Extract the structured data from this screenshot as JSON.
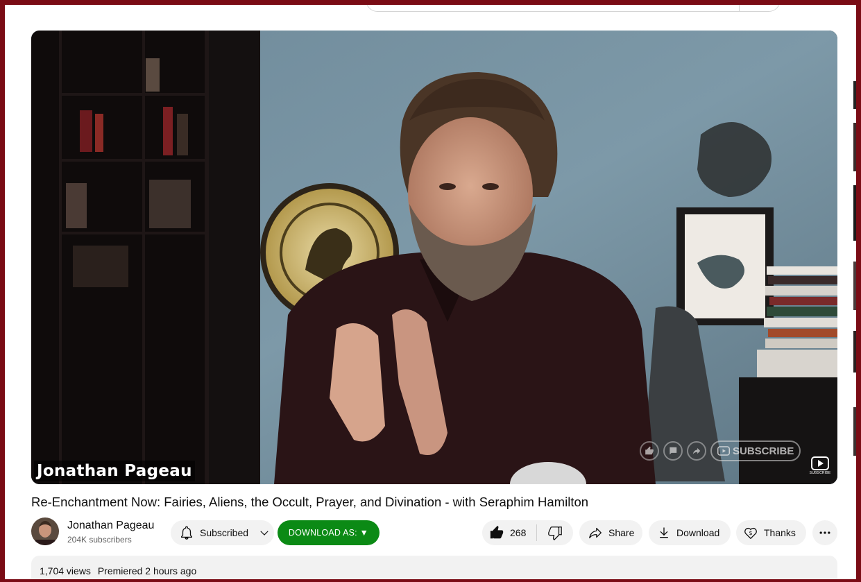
{
  "video": {
    "name_overlay": "Jonathan Pageau",
    "endscreen_subscribe": "SUBSCRIBE",
    "watermark_label": "SUBSCRIBE"
  },
  "title": "Re-Enchantment Now: Fairies, Aliens, the Occult, Prayer, and Divination - with Seraphim Hamilton",
  "channel": {
    "name": "Jonathan Pageau",
    "subscribers": "204K subscribers"
  },
  "actions": {
    "subscribed_label": "Subscribed",
    "download_as_label": "DOWNLOAD AS: ▼",
    "like_count": "268",
    "share_label": "Share",
    "download_label": "Download",
    "thanks_label": "Thanks"
  },
  "description": {
    "views": "1,704 views",
    "premiered": "Premiered 2 hours ago"
  },
  "colors": {
    "frame": "#7a0c15",
    "download_as_bg": "#0b8a15",
    "pill_bg": "#f2f2f2"
  }
}
